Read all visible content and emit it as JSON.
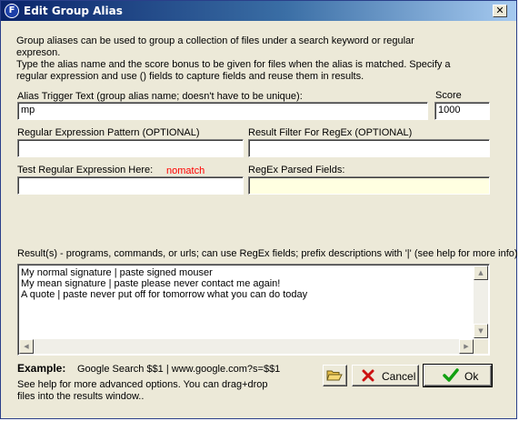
{
  "window": {
    "title": "Edit Group Alias",
    "app_icon_letter": "F",
    "close_glyph": "✕"
  },
  "intro": {
    "line1": "Group aliases can be used to group a collection of files under a search keyword or regular",
    "line2": "expreson.",
    "line3": "Type the alias name and the score bonus to be given for files when the alias is matched.  Specify a",
    "line4": "regular expression and use () fields to capture fields and reuse them in results."
  },
  "alias": {
    "label": "Alias Trigger Text (group alias name; doesn't have to be unique):",
    "value": "mp"
  },
  "score": {
    "label": "Score",
    "value": "1000"
  },
  "regex": {
    "label": "Regular Expression Pattern (OPTIONAL)",
    "value": ""
  },
  "filter": {
    "label": "Result Filter For RegEx (OPTIONAL)",
    "value": ""
  },
  "test": {
    "label": "Test Regular Expression Here:",
    "status": "nomatch",
    "value": ""
  },
  "parsed": {
    "label": "RegEx Parsed Fields:",
    "value": ""
  },
  "results": {
    "label": "Result(s) - programs, commands, or urls; can use RegEx fields; prefix descriptions with '|' (see help for more info)",
    "lines": [
      "My normal signature | paste signed mouser",
      "My mean signature | paste please never contact me again!",
      "A quote | paste never put off for tomorrow what you can do today"
    ]
  },
  "example": {
    "label": "Example:",
    "text": "Google Search $$1 | www.google.com?s=$$1"
  },
  "help": {
    "line1": "See help for more advanced options.  You can drag+drop",
    "line2": "files into the results window.."
  },
  "buttons": {
    "cancel": "Cancel",
    "ok": "Ok"
  },
  "colors": {
    "title_start": "#0a246a",
    "title_end": "#a6caf0",
    "face": "#ece9d8",
    "nomatch": "#ff0000",
    "parsed_bg": "#ffffe1"
  },
  "icons": [
    "app-logo-icon",
    "close-icon",
    "open-folder-icon",
    "x-cancel-icon",
    "checkmark-icon"
  ]
}
